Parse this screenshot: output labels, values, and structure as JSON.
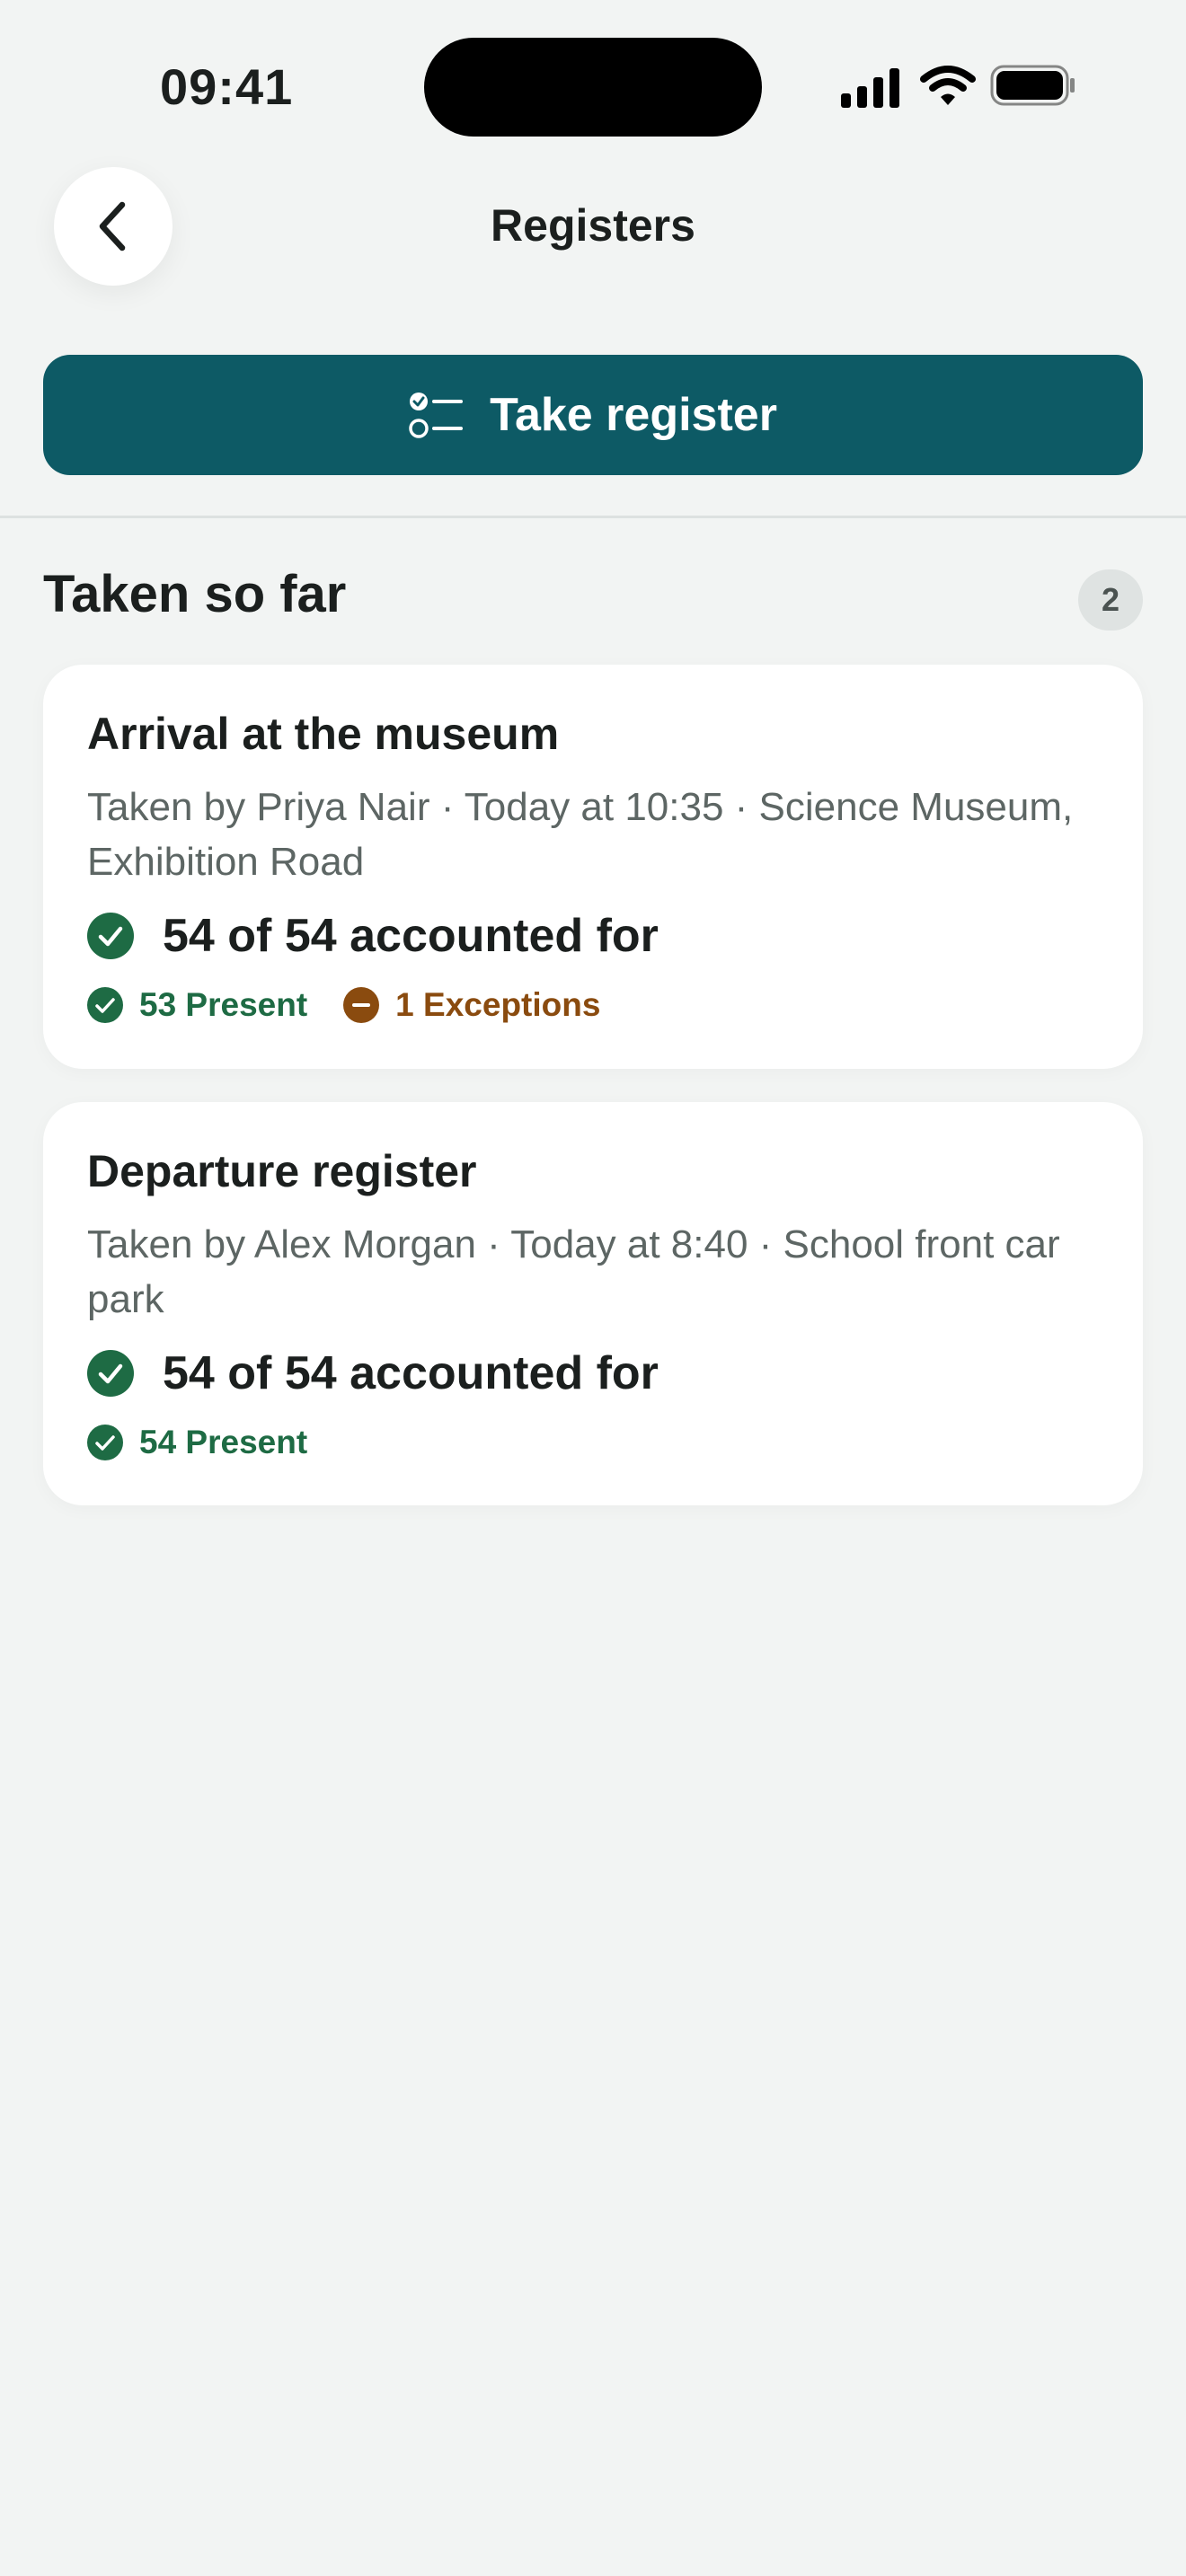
{
  "status_bar": {
    "time": "09:41"
  },
  "header": {
    "title": "Registers",
    "back_icon": "chevron-left-icon"
  },
  "actions": {
    "take_register_label": "Take register",
    "take_register_icon": "checklist-icon"
  },
  "section": {
    "title": "Taken so far",
    "count": "2"
  },
  "registers": [
    {
      "title": "Arrival at the museum",
      "meta": "Taken by Priya Nair · Today at 10:35 · Science Museum, Exhibition Road",
      "accounted": "54 of 54 accounted for",
      "present": "53 Present",
      "exceptions": "1 Exceptions"
    },
    {
      "title": "Departure register",
      "meta": "Taken by Alex Morgan · Today at 8:40 · School front car park",
      "accounted": "54 of 54 accounted for",
      "present": "54 Present"
    }
  ],
  "colors": {
    "primary": "#0d5a65",
    "success": "#1e6b44",
    "warning": "#8a4b0f",
    "background": "#f2f4f3"
  }
}
